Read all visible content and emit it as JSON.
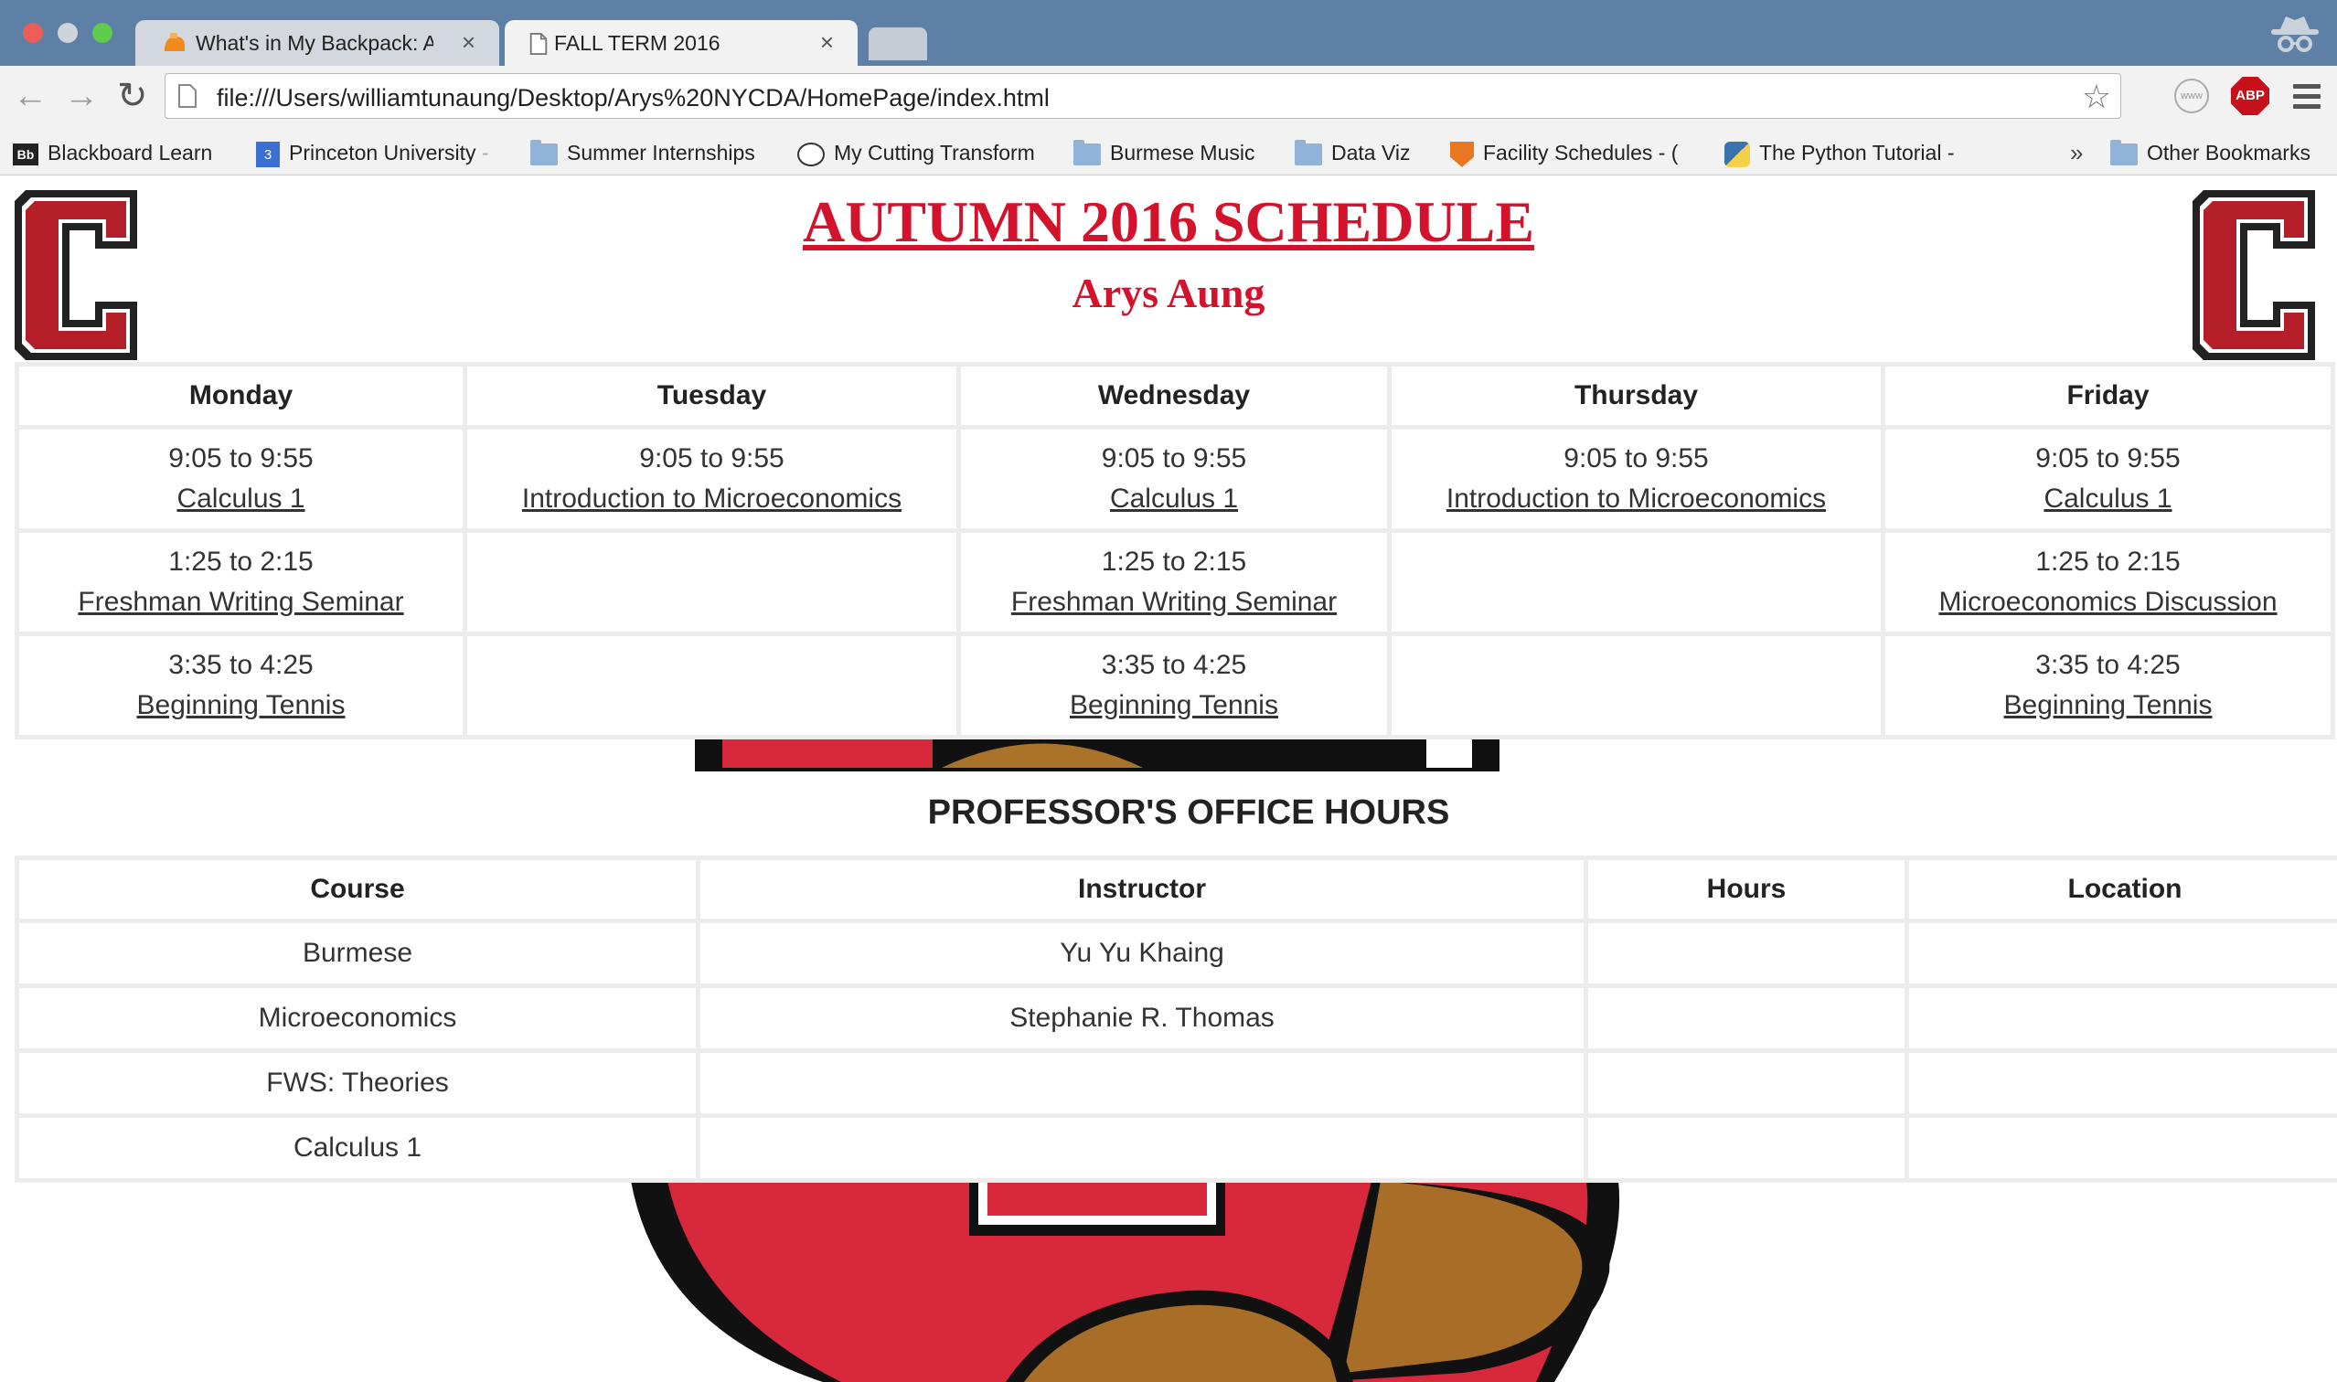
{
  "browser": {
    "tabs": [
      {
        "title": "What's in My Backpack: A T",
        "active": false
      },
      {
        "title": "FALL TERM 2016",
        "active": true
      }
    ],
    "url": "file:///Users/williamtunaung/Desktop/Arys%20NYCDA/HomePage/index.html",
    "extensions": {
      "abp_label": "ABP",
      "www_label": "www"
    },
    "bookmarks": [
      {
        "label": "Blackboard Learn",
        "icon": "blackboard-icon"
      },
      {
        "label": "Princeton University",
        "icon": "calendar-icon",
        "truncated": "-"
      },
      {
        "label": "Summer Internships",
        "icon": "folder-icon"
      },
      {
        "label": "My Cutting Transform",
        "icon": "reddit-icon"
      },
      {
        "label": "Burmese Music",
        "icon": "folder-icon"
      },
      {
        "label": "Data Viz",
        "icon": "folder-icon"
      },
      {
        "label": "Facility Schedules - (",
        "icon": "shield-icon"
      },
      {
        "label": "The Python Tutorial -",
        "icon": "python-icon"
      }
    ],
    "bookmarks_more": "»",
    "other_bookmarks": "Other Bookmarks"
  },
  "page": {
    "title": "AUTUMN 2016 SCHEDULE",
    "subtitle": "Arys Aung",
    "accent_color": "#d3122c",
    "schedule": {
      "headers": [
        "Monday",
        "Tuesday",
        "Wednesday",
        "Thursday",
        "Friday"
      ],
      "rows": [
        [
          {
            "time": "9:05 to 9:55",
            "course": "Calculus 1"
          },
          {
            "time": "9:05 to 9:55",
            "course": "Introduction to Microeconomics"
          },
          {
            "time": "9:05 to 9:55",
            "course": "Calculus 1"
          },
          {
            "time": "9:05 to 9:55",
            "course": "Introduction to Microeconomics"
          },
          {
            "time": "9:05 to 9:55",
            "course": "Calculus 1"
          }
        ],
        [
          {
            "time": "1:25 to 2:15",
            "course": "Freshman Writing Seminar"
          },
          {
            "time": "",
            "course": ""
          },
          {
            "time": "1:25 to 2:15",
            "course": "Freshman Writing Seminar"
          },
          {
            "time": "",
            "course": ""
          },
          {
            "time": "1:25 to 2:15",
            "course": "Microeconomics Discussion"
          }
        ],
        [
          {
            "time": "3:35 to 4:25",
            "course": "Beginning Tennis"
          },
          {
            "time": "",
            "course": ""
          },
          {
            "time": "3:35 to 4:25",
            "course": "Beginning Tennis"
          },
          {
            "time": "",
            "course": ""
          },
          {
            "time": "3:35 to 4:25",
            "course": "Beginning Tennis"
          }
        ]
      ]
    },
    "office_hours": {
      "heading": "PROFESSOR'S OFFICE HOURS",
      "headers": [
        "Course",
        "Instructor",
        "Hours",
        "Location"
      ],
      "rows": [
        [
          "Burmese",
          "Yu Yu Khaing",
          "",
          ""
        ],
        [
          "Microeconomics",
          "Stephanie R. Thomas",
          "",
          ""
        ],
        [
          "FWS: Theories",
          "",
          "",
          ""
        ],
        [
          "Calculus 1",
          "",
          "",
          ""
        ]
      ]
    }
  }
}
